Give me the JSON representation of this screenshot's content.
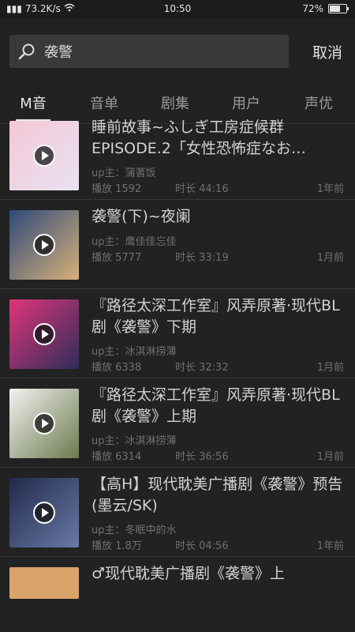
{
  "status": {
    "speed": "73.2K/s",
    "time": "10:50",
    "battery": "72%",
    "battery_level": 0.72
  },
  "search": {
    "query": "袭警",
    "cancel_label": "取消"
  },
  "tabs": [
    "M音",
    "音单",
    "剧集",
    "用户",
    "声优"
  ],
  "active_tab": 0,
  "results": [
    {
      "title": "睡前故事~ふしぎ工房症候群EPISODE.2「女性恐怖症なお…",
      "up": "up主：蒲蓍饭",
      "plays": "播放 1592",
      "duration": "时长 44:16",
      "ago": "1年前",
      "cover_colors": [
        "#f4c7d6",
        "#e9e2f1"
      ]
    },
    {
      "title": "袭警(下)~夜阑",
      "up": "up主：鹰佳佳忘佳",
      "plays": "播放 5777",
      "duration": "时长 33:19",
      "ago": "1月前",
      "cover_colors": [
        "#2e4a78",
        "#d8b07a"
      ]
    },
    {
      "title": "『路径太深工作室』风弄原著·现代BL剧《袭警》下期",
      "up": "up主：冰淇淋捞薄",
      "plays": "播放 6338",
      "duration": "时长 32:32",
      "ago": "1月前",
      "cover_colors": [
        "#e0357a",
        "#2d2d5a"
      ]
    },
    {
      "title": "『路径太深工作室』风弄原著·现代BL剧《袭警》上期",
      "up": "up主：冰淇淋捞薄",
      "plays": "播放 6314",
      "duration": "时长 36:56",
      "ago": "1月前",
      "cover_colors": [
        "#f2f2f0",
        "#6c7a4e"
      ]
    },
    {
      "title": "【高H】现代耽美广播剧《袭警》预告(墨云/SK)",
      "up": "up主：冬眠中的水",
      "plays": "播放 1.8万",
      "duration": "时长 04:56",
      "ago": "1年前",
      "cover_colors": [
        "#1f2a4a",
        "#6a7aa6"
      ]
    }
  ],
  "partial_item_title": "♂现代耽美广播剧《袭警》上"
}
